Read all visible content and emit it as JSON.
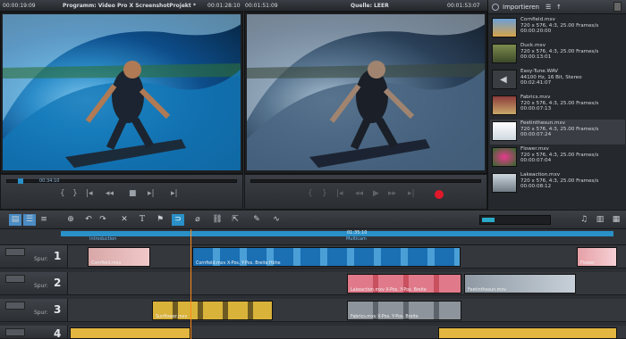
{
  "topbar": {
    "time_left": "00:00:19:09",
    "program_title": "Programm: Video Pro X  ScreenshotProjekt *",
    "time_program": "00:01:28:10",
    "time_source_left": "00:01:51:09",
    "source_title": "Quelle: LEER",
    "time_source_right": "00:01:53:07"
  },
  "preview": {
    "timecode": "00:34:10"
  },
  "media": {
    "import_label": "Importieren",
    "items": [
      {
        "name": "Cornfield.mxv",
        "line2": "720 x 576, 4:3, 25.00 Frames/s",
        "line3": "00:00:20:00"
      },
      {
        "name": "Duck.mxv",
        "line2": "720 x 576, 4:3, 25.00 Frames/s",
        "line3": "00:00:13:01"
      },
      {
        "name": "Easy-Tune.WAV",
        "line2": "44100 Hz, 16 Bit, Stereo",
        "line3": "00:02:41:07"
      },
      {
        "name": "Fabrics.mxv",
        "line2": "720 x 576, 4:3, 25.00 Frames/s",
        "line3": "00:00:07:13"
      },
      {
        "name": "Feetinthesun.mxv",
        "line2": "720 x 576, 4:3, 25.00 Frames/s",
        "line3": "00:00:07:24"
      },
      {
        "name": "Flower.mxv",
        "line2": "720 x 576, 4:3, 25.00 Frames/s",
        "line3": "00:00:07:04"
      },
      {
        "name": "Lakeaction.mxv",
        "line2": "720 x 576, 4:3, 25.00 Frames/s",
        "line3": "00:00:08:12"
      }
    ]
  },
  "ruler": {
    "playhead_time": "01:35:10",
    "marker1": "Introduction",
    "marker2": "Multicam"
  },
  "tracks": [
    {
      "label": "Spur:",
      "number": "1"
    },
    {
      "label": "Spur:",
      "number": "2"
    },
    {
      "label": "Spur:",
      "number": "3"
    },
    {
      "label": "Spur:",
      "number": "4"
    }
  ],
  "clips": {
    "t1a": "Cornfield.mxv",
    "t1b": "Cornfield.mxv  X-Pos.  Y-Pos.  Breite  Höhe",
    "t1c": "Flower",
    "t2a": "Lakeaction.mxv  X-Pos.  Y-Pos.  Breite",
    "t2b": "Feetinthesun.mxv",
    "t3a": "Sunflower.mxv",
    "t3b": "Fabrics.mxv  X-Pos.  Y-Pos.  Breite"
  }
}
